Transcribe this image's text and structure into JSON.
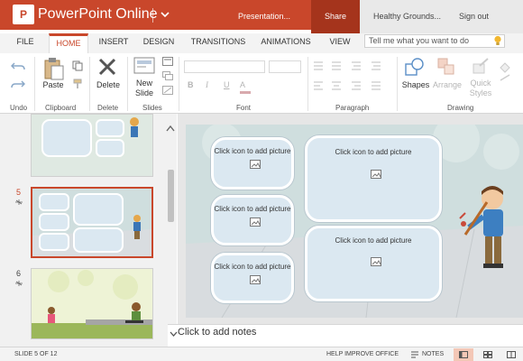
{
  "titlebar": {
    "app_logo_letter": "P",
    "app_title": "PowerPoint Online",
    "document_name": "Presentation...",
    "share_label": "Share",
    "user_name": "Healthy Grounds...",
    "signout_label": "Sign out"
  },
  "tabs": [
    {
      "label": "FILE"
    },
    {
      "label": "HOME",
      "active": true
    },
    {
      "label": "INSERT"
    },
    {
      "label": "DESIGN"
    },
    {
      "label": "TRANSITIONS"
    },
    {
      "label": "ANIMATIONS"
    },
    {
      "label": "VIEW"
    }
  ],
  "tell_me": {
    "placeholder": "Tell me what you want to do"
  },
  "ribbon": {
    "groups": {
      "undo": "Undo",
      "clipboard": "Clipboard",
      "delete": "Delete",
      "slides": "Slides",
      "font": "Font",
      "paragraph": "Paragraph",
      "drawing": "Drawing"
    },
    "paste_label": "Paste",
    "delete_label": "Delete",
    "new_slide_label": "New Slide",
    "new_slide_line1": "New",
    "new_slide_line2": "Slide",
    "shapes_label": "Shapes",
    "arrange_label": "Arrange",
    "quick_styles_line1": "Quick",
    "quick_styles_line2": "Styles",
    "font_buttons": [
      "B",
      "I",
      "U",
      "A"
    ]
  },
  "slide_pane": {
    "slides": [
      {
        "number": "5",
        "current": true
      },
      {
        "number": "6",
        "current": false
      }
    ]
  },
  "main_slide": {
    "placeholders": [
      {
        "text": "Click icon to add picture"
      },
      {
        "text": "Click icon to add picture"
      },
      {
        "text": "Click icon to add picture"
      },
      {
        "text": "Click icon to add picture"
      },
      {
        "text": "Click icon to add picture"
      }
    ]
  },
  "notes": {
    "text": "Click to add notes"
  },
  "statusbar": {
    "slide_indicator": "SLIDE 5 OF 12",
    "help_improve": "HELP IMPROVE OFFICE",
    "notes_label": "NOTES"
  },
  "colors": {
    "accent": "#c9472b",
    "share_bg": "#a5341c",
    "placeholder_fill": "#dbe8f1",
    "slide_bg": "#cfdede"
  }
}
